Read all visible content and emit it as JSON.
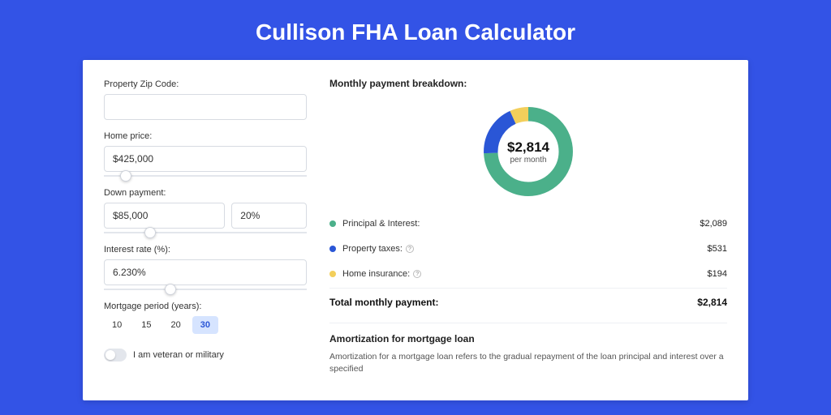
{
  "title": "Cullison FHA Loan Calculator",
  "form": {
    "zip_label": "Property Zip Code:",
    "zip_value": "",
    "home_price_label": "Home price:",
    "home_price_value": "$425,000",
    "home_price_slider_pct": 8,
    "down_payment_label": "Down payment:",
    "down_payment_value": "$85,000",
    "down_payment_pct_value": "20%",
    "down_payment_slider_pct": 20,
    "interest_label": "Interest rate (%):",
    "interest_value": "6.230%",
    "interest_slider_pct": 30,
    "period_label": "Mortgage period (years):",
    "periods": [
      "10",
      "15",
      "20",
      "30"
    ],
    "period_active": "30",
    "veteran_label": "I am veteran or military"
  },
  "breakdown": {
    "title": "Monthly payment breakdown:",
    "donut_amount": "$2,814",
    "donut_sub": "per month",
    "items": [
      {
        "label": "Principal & Interest:",
        "value": "$2,089",
        "color": "#4bb08a",
        "info": false
      },
      {
        "label": "Property taxes:",
        "value": "$531",
        "color": "#2a56d6",
        "info": true
      },
      {
        "label": "Home insurance:",
        "value": "$194",
        "color": "#f3cf5b",
        "info": true
      }
    ],
    "total_label": "Total monthly payment:",
    "total_value": "$2,814"
  },
  "amortization": {
    "title": "Amortization for mortgage loan",
    "text": "Amortization for a mortgage loan refers to the gradual repayment of the loan principal and interest over a specified"
  },
  "chart_data": {
    "type": "pie",
    "title": "Monthly payment breakdown",
    "series": [
      {
        "name": "Principal & Interest",
        "value": 2089,
        "color": "#4bb08a"
      },
      {
        "name": "Property taxes",
        "value": 531,
        "color": "#2a56d6"
      },
      {
        "name": "Home insurance",
        "value": 194,
        "color": "#f3cf5b"
      }
    ],
    "total": 2814
  }
}
